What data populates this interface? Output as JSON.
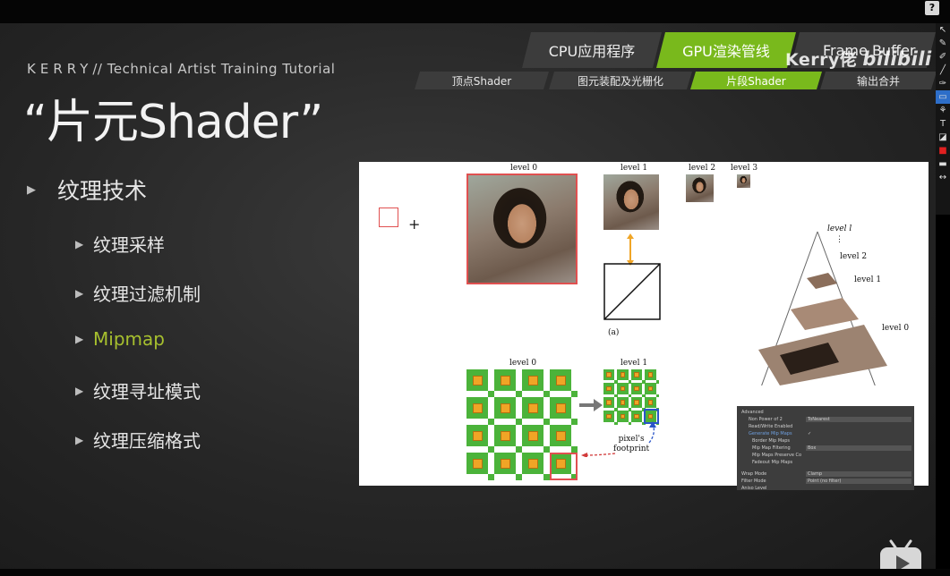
{
  "header": {
    "help_label": "?"
  },
  "slide": {
    "brand_kerry": "KERRY",
    "brand_rest": "// Technical Artist Training Tutorial",
    "title": "“片元Shader”",
    "main_bullet": "纹理技术",
    "sub_bullets": [
      "纹理采样",
      "纹理过滤机制",
      "Mipmap",
      "纹理寻址模式",
      "纹理压缩格式"
    ],
    "active_sub_index": 2,
    "accent_color": "#a7c02e"
  },
  "pipeline_tabs": {
    "stages": [
      "CPU应用程序",
      "GPU渲染管线",
      "Frame Buffer"
    ],
    "active_stage": "GPU渲染管线",
    "gpu_substages": [
      "顶点Shader",
      "图元装配及光栅化",
      "片段Shader",
      "输出合并"
    ],
    "active_substage": "片段Shader",
    "active_color": "#79b91c"
  },
  "watermark": {
    "author": "Kerry佬",
    "site": "bilibili"
  },
  "figure": {
    "top_labels": [
      "level 0",
      "level 1",
      "level 2",
      "level 3"
    ],
    "plus": "+",
    "caption_a": "(a)",
    "pyramid_labels": [
      "level l",
      "⋮",
      "level 2",
      "level 1",
      "level 0"
    ],
    "bottom_label_level0": "level 0",
    "bottom_label_level1": "level 1",
    "footprint_label": "pixel's\nfootprint",
    "unity_panel": {
      "rows": [
        {
          "label": "Advanced",
          "value": ""
        },
        {
          "label": "Non Power of 2",
          "value": "ToNearest"
        },
        {
          "label": "Read/Write Enabled",
          "value": ""
        },
        {
          "label": "Generate Mip Maps",
          "value": "✓"
        },
        {
          "label": "Border Mip Maps",
          "value": ""
        },
        {
          "label": "Mip Map Filtering",
          "value": "Box"
        },
        {
          "label": "Mip Maps Preserve Co",
          "value": ""
        },
        {
          "label": "Fadeout Mip Maps",
          "value": ""
        },
        {
          "label": "Wrap Mode",
          "value": "Clamp"
        },
        {
          "label": "Filter Mode",
          "value": "Point (no filter)"
        },
        {
          "label": "Aniso Level",
          "value": ""
        }
      ]
    }
  },
  "toolbar": {
    "tools": [
      "cursor-icon",
      "pen-icon",
      "marker-icon",
      "line-icon",
      "brush-icon",
      "rectangle-icon",
      "fill-icon",
      "text-icon",
      "eraser-icon",
      "color-red-icon",
      "line-width-icon",
      "expand-icon"
    ],
    "selected_tool": "rectangle-icon"
  },
  "player": {
    "button": "play-icon"
  }
}
